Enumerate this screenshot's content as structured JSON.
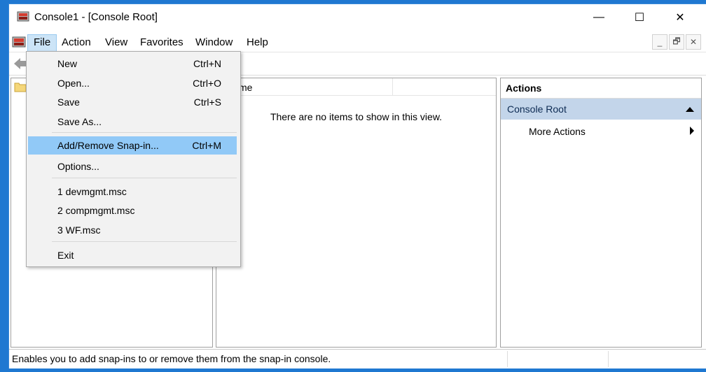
{
  "window": {
    "title": "Console1 - [Console Root]"
  },
  "caption_buttons": {
    "minimize": "—",
    "maximize": "☐",
    "close": "✕"
  },
  "menubar": {
    "items": [
      {
        "label": "File",
        "active": true
      },
      {
        "label": "Action"
      },
      {
        "label": "View"
      },
      {
        "label": "Favorites"
      },
      {
        "label": "Window"
      },
      {
        "label": "Help"
      }
    ],
    "mdi_buttons": [
      "_",
      "🗗",
      "✕"
    ]
  },
  "file_menu": {
    "items": [
      {
        "label": "New",
        "shortcut": "Ctrl+N"
      },
      {
        "label": "Open...",
        "shortcut": "Ctrl+O"
      },
      {
        "label": "Save",
        "shortcut": "Ctrl+S"
      },
      {
        "label": "Save As..."
      },
      {
        "label": "Add/Remove Snap-in...",
        "shortcut": "Ctrl+M",
        "highlighted": true
      },
      {
        "label": "Options..."
      },
      {
        "label": "1 devmgmt.msc"
      },
      {
        "label": "2 compmgmt.msc"
      },
      {
        "label": "3 WF.msc"
      },
      {
        "label": "Exit"
      }
    ]
  },
  "center_pane": {
    "column_header": "me",
    "empty_message": "There are no items to show in this view."
  },
  "actions_pane": {
    "header": "Actions",
    "section": "Console Root",
    "items": [
      "More Actions"
    ]
  },
  "status_bar": {
    "text": "Enables you to add snap-ins to or remove them from the snap-in console."
  },
  "colors": {
    "desktop": "#1f78d1",
    "menu_highlight": "#91c9f7",
    "actions_section": "#c3d5ea"
  }
}
